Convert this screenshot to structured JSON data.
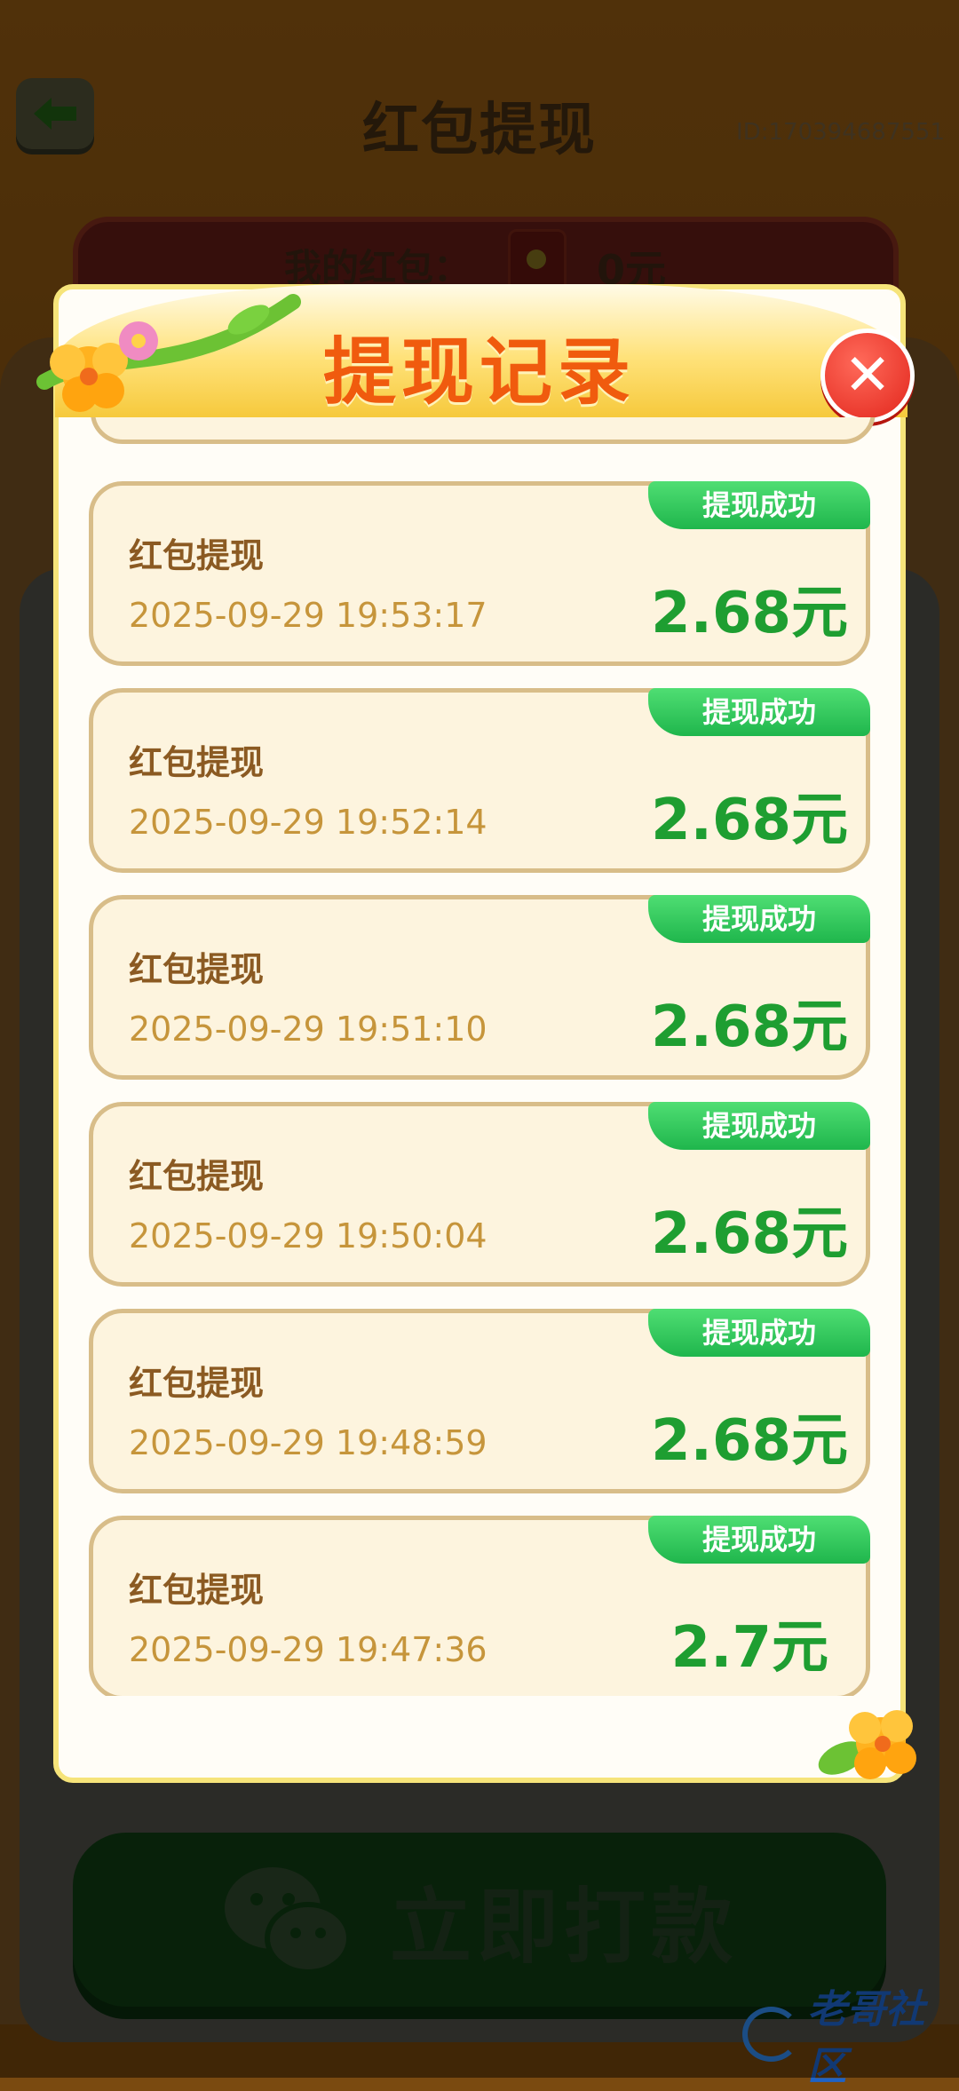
{
  "page": {
    "title": "红包提现",
    "user_id": "ID:170394687551"
  },
  "wallet": {
    "label": "我的红包：",
    "amount": "0元"
  },
  "pay_button": {
    "label": "立即打款"
  },
  "modal": {
    "title": "提现记录",
    "records": [
      {
        "title": "红包提现",
        "time": "2025-09-29 19:53:17",
        "amount": "2.68元",
        "status": "提现成功"
      },
      {
        "title": "红包提现",
        "time": "2025-09-29 19:52:14",
        "amount": "2.68元",
        "status": "提现成功"
      },
      {
        "title": "红包提现",
        "time": "2025-09-29 19:51:10",
        "amount": "2.68元",
        "status": "提现成功"
      },
      {
        "title": "红包提现",
        "time": "2025-09-29 19:50:04",
        "amount": "2.68元",
        "status": "提现成功"
      },
      {
        "title": "红包提现",
        "time": "2025-09-29 19:48:59",
        "amount": "2.68元",
        "status": "提现成功"
      },
      {
        "title": "红包提现",
        "time": "2025-09-29 19:47:36",
        "amount": "2.7元",
        "status": "提现成功"
      }
    ]
  },
  "watermark": {
    "text": "老哥社区"
  },
  "colors": {
    "accent_orange": "#f05b0e",
    "success_green": "#1e9e31",
    "badge_green": "#2cc55a",
    "close_red": "#e2261c"
  },
  "icons": [
    "back-arrow-icon",
    "close-icon",
    "red-envelope-icon",
    "wechat-icon",
    "flower-icon",
    "vine-icon"
  ]
}
